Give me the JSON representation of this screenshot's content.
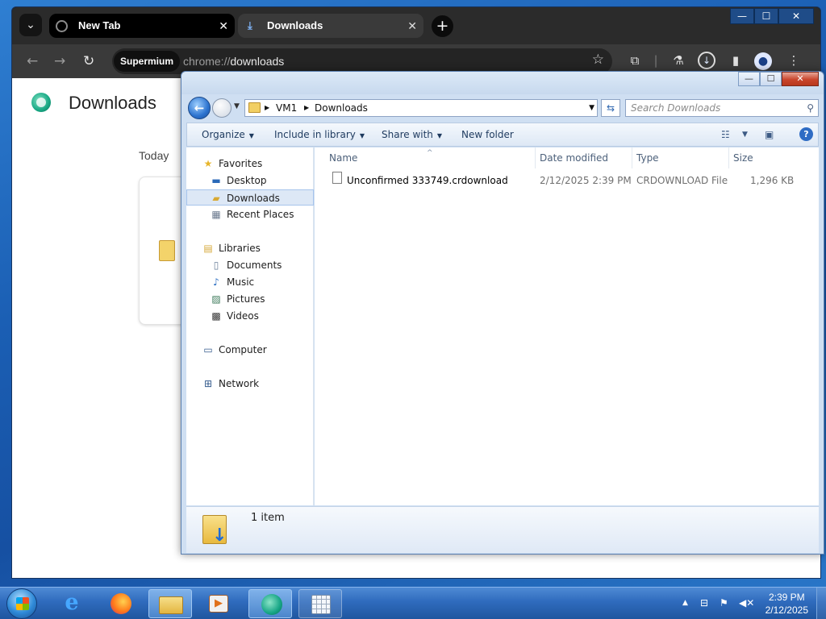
{
  "browser": {
    "tabs": [
      {
        "label": "New Tab"
      },
      {
        "label": "Downloads"
      }
    ],
    "tab_close_glyph": "✕",
    "new_tab_glyph": "+",
    "window_controls": {
      "minimize": "—",
      "maximize": "☐",
      "close": "✕"
    },
    "omnibox": {
      "chip": "Supermium",
      "url_scheme": "chrome://",
      "url_path": "downloads"
    },
    "page": {
      "title": "Downloads",
      "section": "Today"
    }
  },
  "explorer": {
    "window_controls": {
      "minimize": "—",
      "maximize": "☐",
      "close": "✕"
    },
    "breadcrumb": [
      "VM1",
      "Downloads"
    ],
    "search_placeholder": "Search Downloads",
    "commands": {
      "organize": "Organize",
      "include_in_library": "Include in library",
      "share_with": "Share with",
      "new_folder": "New folder"
    },
    "nav": {
      "favorites": "Favorites",
      "desktop": "Desktop",
      "downloads": "Downloads",
      "recent_places": "Recent Places",
      "libraries": "Libraries",
      "documents": "Documents",
      "music": "Music",
      "pictures": "Pictures",
      "videos": "Videos",
      "computer": "Computer",
      "network": "Network"
    },
    "columns": {
      "name": "Name",
      "date_modified": "Date modified",
      "type": "Type",
      "size": "Size"
    },
    "files": [
      {
        "name": "Unconfirmed 333749.crdownload",
        "date_modified": "2/12/2025 2:39 PM",
        "type": "CRDOWNLOAD File",
        "size": "1,296 KB"
      }
    ],
    "details": {
      "item_count": "1 item"
    }
  },
  "taskbar": {
    "clock": {
      "time": "2:39 PM",
      "date": "2/12/2025"
    }
  },
  "colors": {
    "desktop": "#1b5fb4",
    "taskbar": "#2f6bbd",
    "browser_dark": "#3a3a3a",
    "explorer_frame": "#cfdff2",
    "close_red": "#c9452c"
  }
}
